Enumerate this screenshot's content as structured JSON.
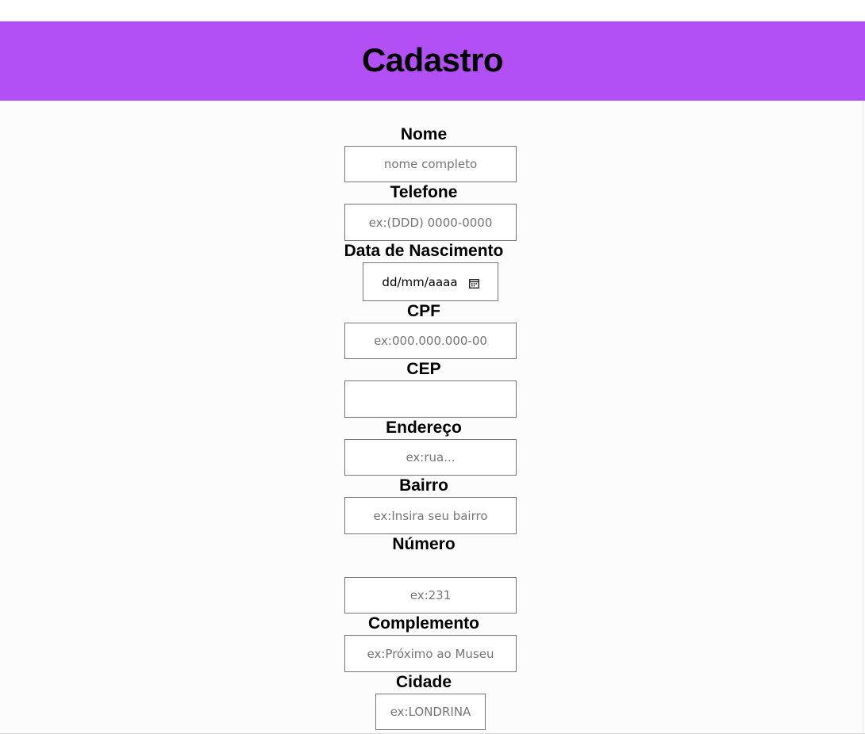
{
  "header": {
    "title": "Cadastro",
    "background": "#b24ff5"
  },
  "form": {
    "nome": {
      "label": "Nome",
      "placeholder": "nome completo"
    },
    "telefone": {
      "label": "Telefone",
      "placeholder": "ex:(DDD) 0000-0000"
    },
    "nascimento": {
      "label": "Data de Nascimento",
      "format": "dd/mm/aaaa",
      "icon": "calendar-icon"
    },
    "cpf": {
      "label": "CPF",
      "placeholder": "ex:000.000.000-00"
    },
    "cep": {
      "label": "CEP",
      "placeholder": ""
    },
    "endereco": {
      "label": "Endereço",
      "placeholder": "ex:rua..."
    },
    "bairro": {
      "label": "Bairro",
      "placeholder": "ex:Insira seu bairro"
    },
    "numero": {
      "label": "Número",
      "placeholder": "ex:231"
    },
    "complemento": {
      "label": "Complemento",
      "placeholder": "ex:Próximo ao Museu"
    },
    "cidade": {
      "label": "Cidade",
      "placeholder": "ex:LONDRINA"
    }
  }
}
